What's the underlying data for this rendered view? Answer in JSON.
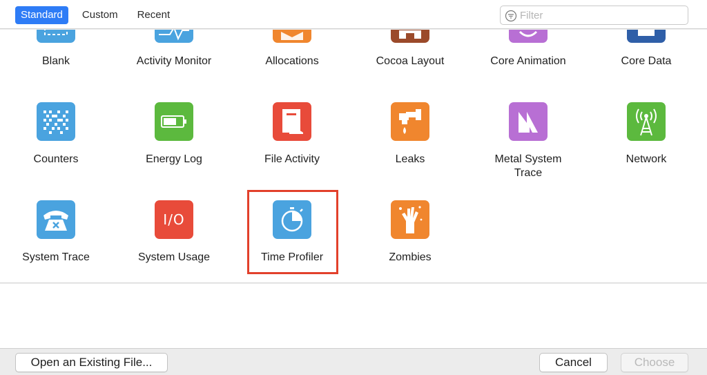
{
  "tabs": [
    {
      "label": "Standard",
      "active": true
    },
    {
      "label": "Custom",
      "active": false
    },
    {
      "label": "Recent",
      "active": false
    }
  ],
  "filter": {
    "placeholder": "Filter",
    "icon": "filter-icon"
  },
  "templates": {
    "blank": {
      "label": "Blank",
      "color": "#4aa3df",
      "icon": "blank-icon"
    },
    "activity_monitor": {
      "label": "Activity Monitor",
      "color": "#4aa3df",
      "icon": "activity-monitor-icon"
    },
    "allocations": {
      "label": "Allocations",
      "color": "#f0862e",
      "icon": "allocations-icon"
    },
    "cocoa_layout": {
      "label": "Cocoa Layout",
      "color": "#9b4a2a",
      "icon": "cocoa-layout-icon"
    },
    "core_animation": {
      "label": "Core Animation",
      "color": "#b86fd4",
      "icon": "core-animation-icon"
    },
    "core_data": {
      "label": "Core Data",
      "color": "#2f5fa8",
      "icon": "core-data-icon"
    },
    "counters": {
      "label": "Counters",
      "color": "#4aa3df",
      "icon": "counters-icon"
    },
    "energy_log": {
      "label": "Energy Log",
      "color": "#5cb93e",
      "icon": "battery-icon"
    },
    "file_activity": {
      "label": "File Activity",
      "color": "#e84b3a",
      "icon": "file-activity-icon"
    },
    "leaks": {
      "label": "Leaks",
      "color": "#f0862e",
      "icon": "faucet-icon"
    },
    "metal_system_trace": {
      "label_line1": "Metal System",
      "label_line2": "Trace",
      "color": "#b86fd4",
      "icon": "metal-icon"
    },
    "network": {
      "label": "Network",
      "color": "#5cb93e",
      "icon": "antenna-icon"
    },
    "system_trace": {
      "label": "System Trace",
      "color": "#4aa3df",
      "icon": "telephone-icon"
    },
    "system_usage": {
      "label": "System Usage",
      "color": "#e84b3a",
      "icon": "io-icon",
      "glyph": "I/O"
    },
    "time_profiler": {
      "label": "Time Profiler",
      "color": "#4aa3df",
      "icon": "stopwatch-icon",
      "selected": true
    },
    "zombies": {
      "label": "Zombies",
      "color": "#f0862e",
      "icon": "zombie-hand-icon"
    }
  },
  "footer": {
    "open_label": "Open an Existing File...",
    "cancel_label": "Cancel",
    "choose_label": "Choose"
  },
  "colors": {
    "accent": "#2e7cf6",
    "highlight": "#e2402b"
  }
}
